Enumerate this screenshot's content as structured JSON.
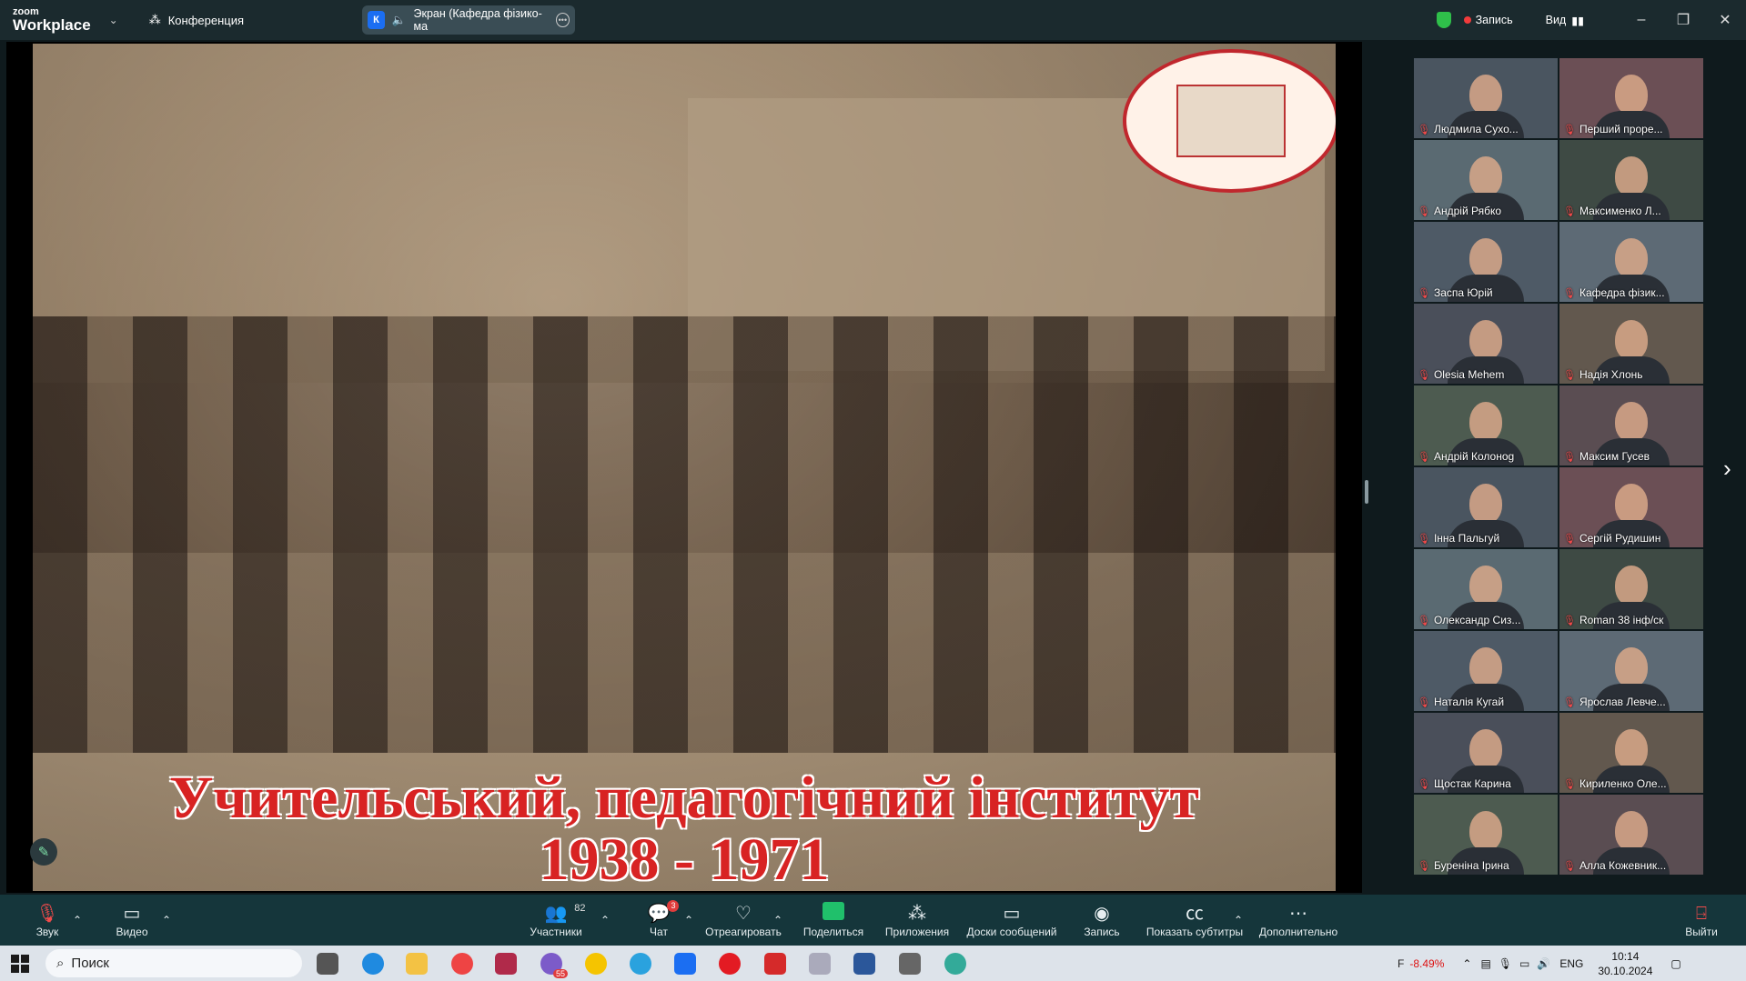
{
  "titlebar": {
    "logo_small": "zoom",
    "logo_large": "Workplace",
    "conference_label": "Конференция",
    "share_initial": "К",
    "share_label": "Экран (Кафедра фізико-ма",
    "record_label": "Запись",
    "view_label": "Вид",
    "minimize_icon": "–",
    "maximize_icon": "❐",
    "close_icon": "✕"
  },
  "presentation": {
    "caption_line1": "Учительський, педагогічний інститут",
    "caption_line2": "1938 - 1971"
  },
  "gallery": [
    {
      "name": "Людмила Сухо..."
    },
    {
      "name": "Перший прорe..."
    },
    {
      "name": "Андрій Рябко"
    },
    {
      "name": "Максименко Л..."
    },
    {
      "name": "Заспа Юрій"
    },
    {
      "name": "Кафедра фізик..."
    },
    {
      "name": "Olesia Mehem"
    },
    {
      "name": "Надія Хлонь"
    },
    {
      "name": "Андрій Колонog"
    },
    {
      "name": "Максим Гусев"
    },
    {
      "name": "Інна Пальгуй"
    },
    {
      "name": "Сергій Рудишин"
    },
    {
      "name": "Олександр Сиз..."
    },
    {
      "name": "Roman 38 інф/ск"
    },
    {
      "name": "Наталія Кугай"
    },
    {
      "name": "Ярослав Левче..."
    },
    {
      "name": "Щостак  Карина"
    },
    {
      "name": "Кириленко Оле..."
    },
    {
      "name": "Бурeніна Ірина"
    },
    {
      "name": "Алла Кожевник..."
    }
  ],
  "toolbar": {
    "audio": "Звук",
    "video": "Видео",
    "participants": "Участники",
    "participants_count": "82",
    "chat": "Чат",
    "chat_badge": "3",
    "react": "Отреагировать",
    "share": "Поделиться",
    "apps": "Приложения",
    "whiteboards": "Доски сообщений",
    "record": "Запись",
    "captions": "Показать субтитры",
    "more": "Дополнительно",
    "leave": "Выйти"
  },
  "taskbar": {
    "search_placeholder": "Поиск",
    "stock_label": "F",
    "stock_change": "-8.49%",
    "language": "ENG",
    "time": "10:14",
    "date": "30.10.2024",
    "viber_badge": "55"
  },
  "colors": {
    "toolbar_bg": "#15363b",
    "titlebar_bg": "#1b2a2e",
    "record_red": "#f23b3b",
    "caption_red": "#d82323",
    "share_green": "#20c06b"
  }
}
